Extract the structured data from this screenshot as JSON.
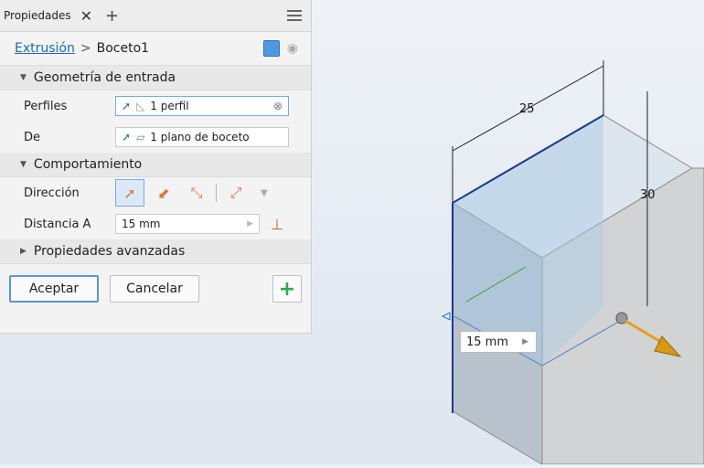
{
  "tab": {
    "label": "Propiedades",
    "close": "✕",
    "add": "+"
  },
  "breadcrumb": {
    "link": "Extrusión",
    "sep": ">",
    "current": "Boceto1"
  },
  "sections": {
    "input_geometry": "Geometría de entrada",
    "behavior": "Comportamiento",
    "advanced": "Propiedades avanzadas"
  },
  "fields": {
    "profiles": {
      "label": "Perfiles",
      "value": "1 perfil"
    },
    "from": {
      "label": "De",
      "value": "1 plano de boceto"
    },
    "direction": {
      "label": "Dirección"
    },
    "distance": {
      "label": "Distancia A",
      "value": "15 mm"
    }
  },
  "buttons": {
    "ok": "Aceptar",
    "cancel": "Cancelar",
    "add": "+"
  },
  "viewport": {
    "dim_width": "25",
    "dim_height": "30",
    "distance_input": "15 mm"
  },
  "colors": {
    "accent": "#1a6bb5",
    "green_plus": "#2fa84f",
    "arrow_orange": "#e0a11a"
  }
}
